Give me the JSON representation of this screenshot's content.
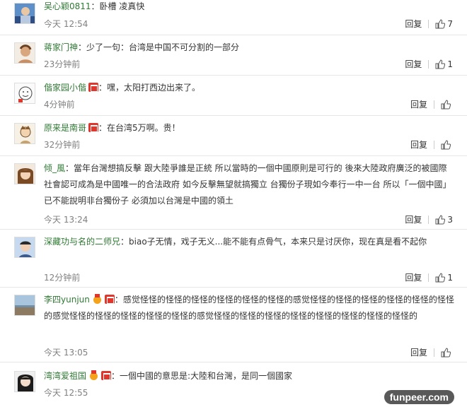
{
  "comments": [
    {
      "user": "吴心颖0811",
      "badges": [],
      "text": "：卧槽 凌真快",
      "time": "今天 12:54",
      "reply": "回复",
      "likes": "7"
    },
    {
      "user": "蒋家门神",
      "badges": [],
      "text": "：少了一句：台湾是中国不可分割的一部分",
      "time": "23分钟前",
      "reply": "回复",
      "likes": "1"
    },
    {
      "user": "偕家园小偕",
      "badges": [
        "vip"
      ],
      "text": "：嘿，太阳打西边出来了。",
      "time": "4分钟前",
      "reply": "回复",
      "likes": ""
    },
    {
      "user": "原来是南哥",
      "badges": [
        "vip"
      ],
      "text": "：在台湾5万啊。贵！",
      "time": "32分钟前",
      "reply": "回复",
      "likes": ""
    },
    {
      "user": "倾_風",
      "badges": [],
      "text": "：當年台灣想搞反擊 跟大陸爭誰是正統 所以當時的一個中國原則是可行的 後來大陸政府廣泛的被國際社會認可成為是中國唯一的合法政府 如今反擊無望就搞獨立 台獨份子現如今奉行一中一台 所以「一個中國」已不能說明非台獨份子 必須加以台灣是中國的領土",
      "time": "今天 13:24",
      "reply": "回复",
      "likes": "3"
    },
    {
      "user": "深藏功与名的二师兄",
      "badges": [],
      "text": "：biao子无情，戏子无义...能不能有点骨气，本来只是讨厌你，现在真是看不起你",
      "time": "12分钟前",
      "reply": "回复",
      "likes": "1"
    },
    {
      "user": "李四yunjun",
      "badges": [
        "medal",
        "vip"
      ],
      "text": "：感觉怪怪的怪怪的怪怪的怪怪的怪怪的怪怪的感觉怪怪的怪怪的怪怪的怪怪的怪怪的怪怪的感觉怪怪的怪怪的怪怪的怪怪的怪怪的感觉怪怪的怪怪的怪怪的怪怪的怪怪的怪怪的怪怪的怪怪的",
      "time": "今天 13:05",
      "reply": "回复",
      "likes": ""
    },
    {
      "user": "湾湾爱祖国",
      "badges": [
        "medal",
        "vip"
      ],
      "text": "：一個中國的意思是:大陸和台灣，是同一個國家",
      "time": "今天 12:55",
      "reply": "回复",
      "likes": ""
    }
  ],
  "watermark": "funpeer.com",
  "colors": {
    "username": "#2f7a33",
    "vip": "#e0362c",
    "time": "#808080"
  }
}
